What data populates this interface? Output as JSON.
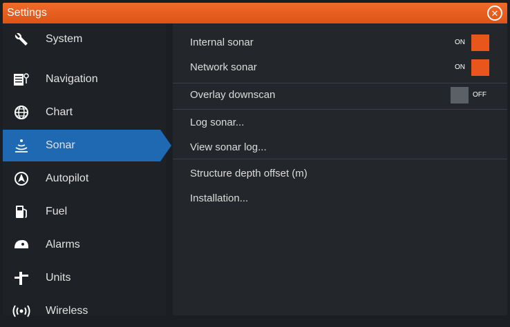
{
  "window": {
    "title": "Settings",
    "close_icon": "close-circle-icon"
  },
  "sidebar": {
    "items": [
      {
        "label": "System",
        "icon": "wrench-icon"
      },
      {
        "label": "Navigation",
        "icon": "navigation-icon"
      },
      {
        "label": "Chart",
        "icon": "globe-icon"
      },
      {
        "label": "Sonar",
        "icon": "sonar-icon",
        "selected": true
      },
      {
        "label": "Autopilot",
        "icon": "autopilot-icon"
      },
      {
        "label": "Fuel",
        "icon": "fuel-icon"
      },
      {
        "label": "Alarms",
        "icon": "alarm-icon"
      },
      {
        "label": "Units",
        "icon": "units-icon"
      },
      {
        "label": "Wireless",
        "icon": "wireless-icon"
      }
    ]
  },
  "settings": {
    "rows": [
      {
        "label": "Internal sonar",
        "toggle": "ON"
      },
      {
        "label": "Network sonar",
        "toggle": "ON"
      },
      {
        "label": "Overlay downscan",
        "toggle": "OFF"
      },
      {
        "label": "Log sonar..."
      },
      {
        "label": "View sonar log..."
      },
      {
        "label": "Structure depth offset (m)"
      },
      {
        "label": "Installation..."
      }
    ]
  },
  "colors": {
    "accent": "#e8561d",
    "selection": "#1f69b3",
    "background": "#1b1e22"
  }
}
